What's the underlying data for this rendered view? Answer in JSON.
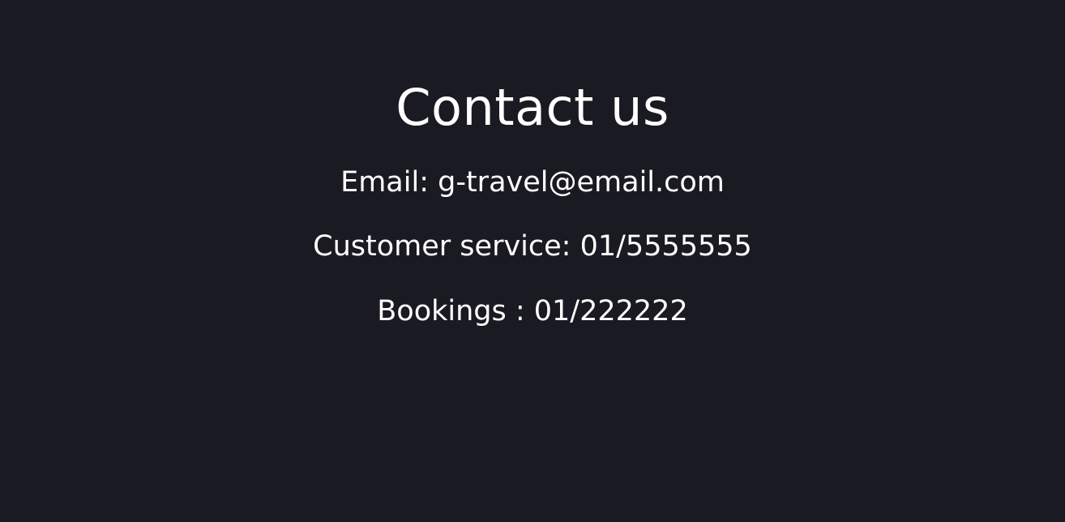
{
  "contact": {
    "title": "Contact us",
    "email_line": "Email: g-travel@email.com",
    "customer_service_line": "Customer service: 01/5555555",
    "bookings_line": "Bookings : 01/222222"
  },
  "colors": {
    "background": "#1a1a22",
    "text": "#ffffff"
  }
}
